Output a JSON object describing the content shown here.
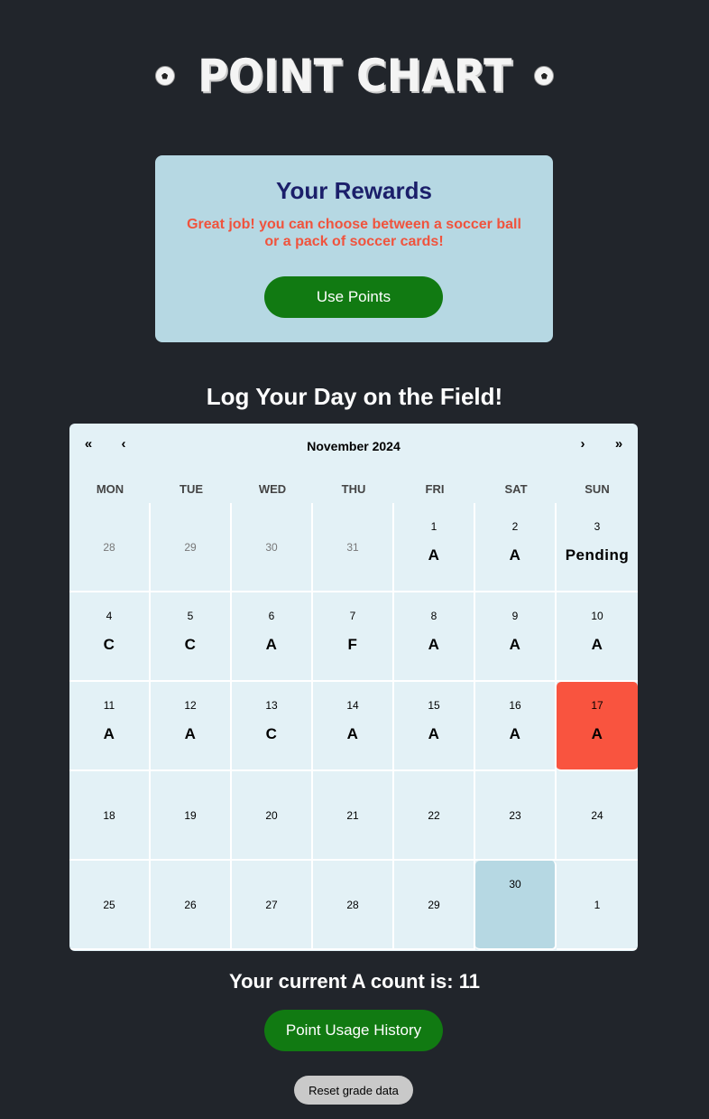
{
  "header": {
    "title": "Point Chart",
    "left_icon": "soccer-ball-icon",
    "right_icon": "soccer-ball-icon"
  },
  "rewards": {
    "heading": "Your Rewards",
    "message": "Great job! you can choose between a soccer ball or a pack of soccer cards!",
    "button_label": "Use Points"
  },
  "log_heading": "Log Your Day on the Field!",
  "calendar": {
    "month_label": "November 2024",
    "nav": {
      "prev_year": "«",
      "prev_month": "‹",
      "next_month": "›",
      "next_year": "»"
    },
    "weekdays": [
      "MON",
      "TUE",
      "WED",
      "THU",
      "FRI",
      "SAT",
      "SUN"
    ],
    "cells": [
      {
        "day": "28",
        "grade": "",
        "state": "muted"
      },
      {
        "day": "29",
        "grade": "",
        "state": "muted"
      },
      {
        "day": "30",
        "grade": "",
        "state": "muted"
      },
      {
        "day": "31",
        "grade": "",
        "state": "muted"
      },
      {
        "day": "1",
        "grade": "A",
        "state": ""
      },
      {
        "day": "2",
        "grade": "A",
        "state": ""
      },
      {
        "day": "3",
        "grade": "Pending",
        "state": ""
      },
      {
        "day": "4",
        "grade": "C",
        "state": ""
      },
      {
        "day": "5",
        "grade": "C",
        "state": ""
      },
      {
        "day": "6",
        "grade": "A",
        "state": ""
      },
      {
        "day": "7",
        "grade": "F",
        "state": ""
      },
      {
        "day": "8",
        "grade": "A",
        "state": ""
      },
      {
        "day": "9",
        "grade": "A",
        "state": ""
      },
      {
        "day": "10",
        "grade": "A",
        "state": ""
      },
      {
        "day": "11",
        "grade": "A",
        "state": ""
      },
      {
        "day": "12",
        "grade": "A",
        "state": ""
      },
      {
        "day": "13",
        "grade": "C",
        "state": ""
      },
      {
        "day": "14",
        "grade": "A",
        "state": ""
      },
      {
        "day": "15",
        "grade": "A",
        "state": ""
      },
      {
        "day": "16",
        "grade": "A",
        "state": ""
      },
      {
        "day": "17",
        "grade": "A",
        "state": "today"
      },
      {
        "day": "18",
        "grade": "",
        "state": "empty"
      },
      {
        "day": "19",
        "grade": "",
        "state": "empty"
      },
      {
        "day": "20",
        "grade": "",
        "state": "empty"
      },
      {
        "day": "21",
        "grade": "",
        "state": "empty"
      },
      {
        "day": "22",
        "grade": "",
        "state": "empty"
      },
      {
        "day": "23",
        "grade": "",
        "state": "empty"
      },
      {
        "day": "24",
        "grade": "",
        "state": "empty"
      },
      {
        "day": "25",
        "grade": "",
        "state": "empty"
      },
      {
        "day": "26",
        "grade": "",
        "state": "empty"
      },
      {
        "day": "27",
        "grade": "",
        "state": "empty"
      },
      {
        "day": "28",
        "grade": "",
        "state": "empty"
      },
      {
        "day": "29",
        "grade": "",
        "state": "empty"
      },
      {
        "day": "30",
        "grade": "",
        "state": "selected"
      },
      {
        "day": "1",
        "grade": "",
        "state": "empty"
      }
    ]
  },
  "count_text": "Your current A count is: 11",
  "history_button_label": "Point Usage History",
  "reset_button_label": "Reset grade data",
  "colors": {
    "background": "#21252b",
    "rewards_panel": "#b6d8e3",
    "accent_green": "#117a12",
    "today_highlight": "#f9543f",
    "selected_highlight": "#b6d8e3"
  }
}
